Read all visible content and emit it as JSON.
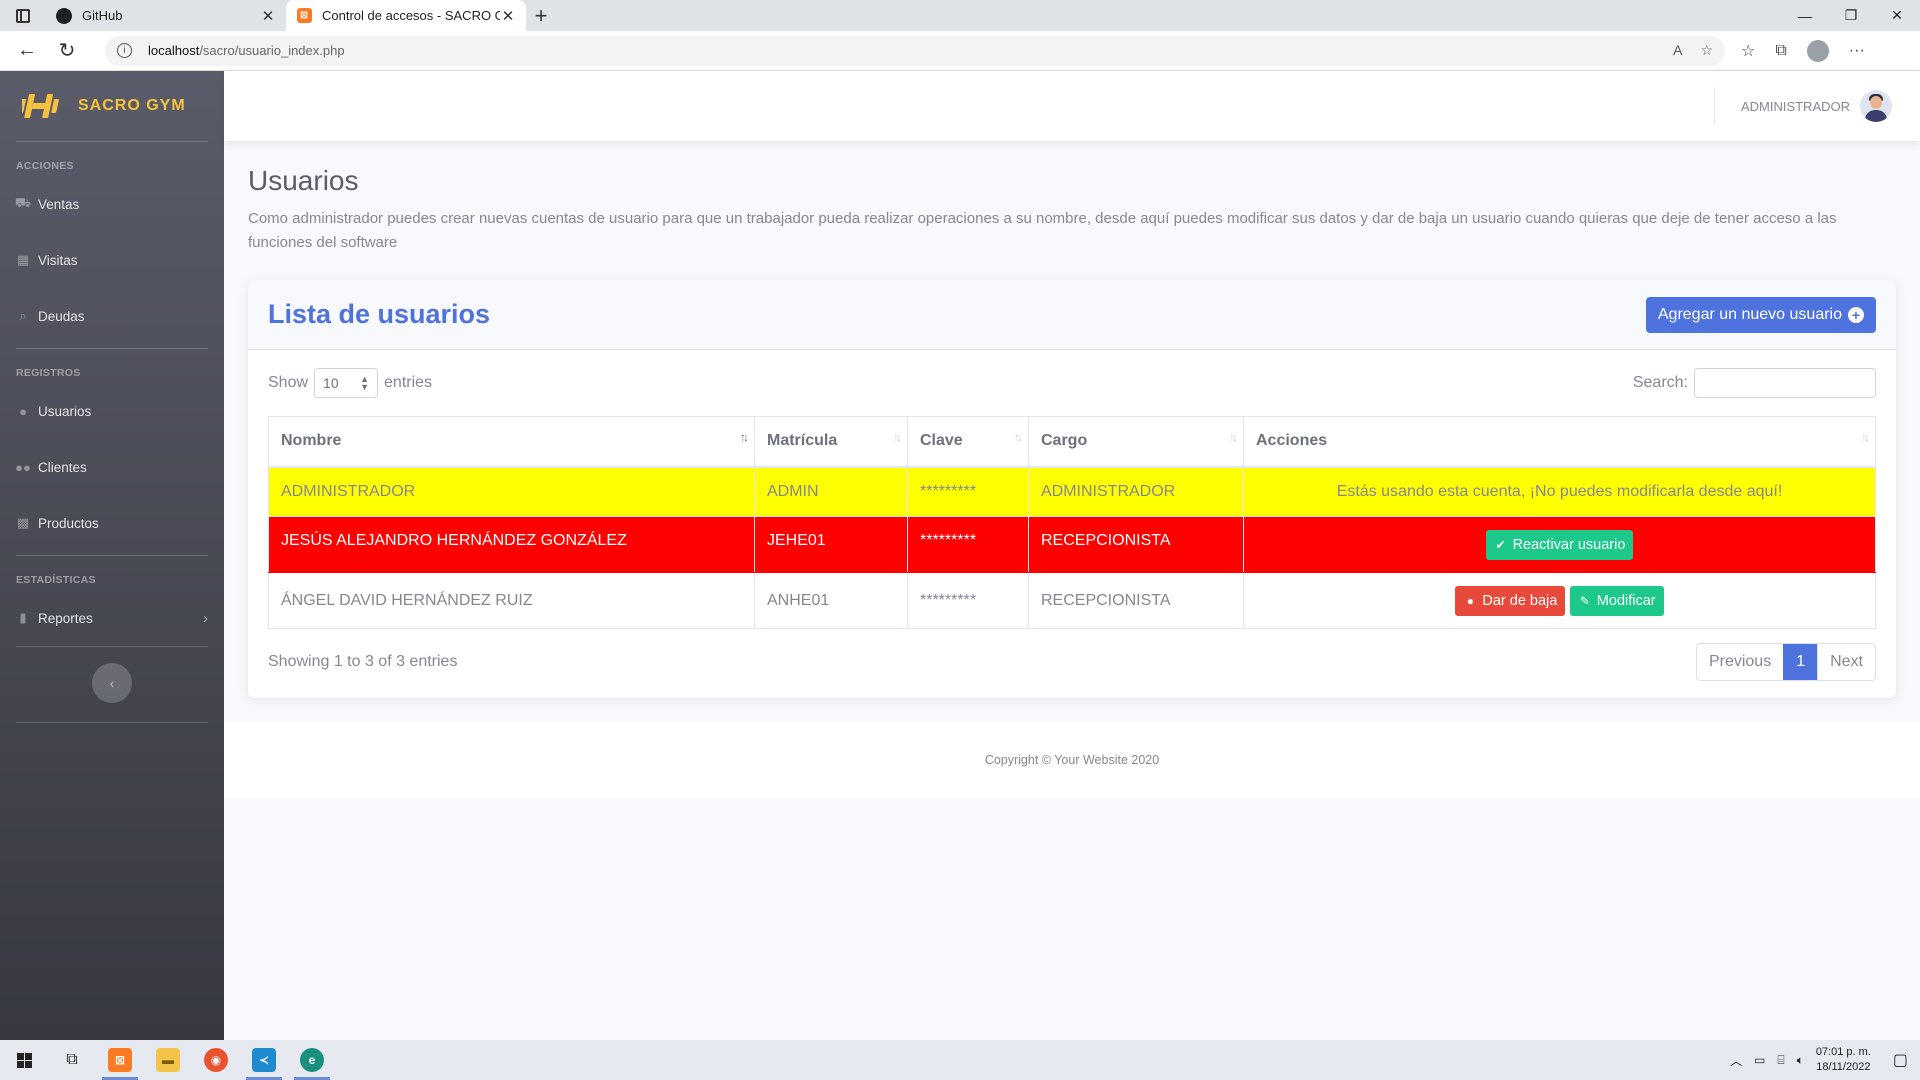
{
  "browser": {
    "tabs": [
      {
        "title": "GitHub",
        "active": false
      },
      {
        "title": "Control de accesos - SACRO GYM",
        "active": true
      }
    ],
    "url_host": "localhost",
    "url_path": "/sacro/usuario_index.php"
  },
  "sidebar": {
    "brand": "SACRO GYM",
    "sections": [
      {
        "heading": "ACCIONES",
        "items": [
          {
            "label": "Ventas",
            "icon": "dolly-icon"
          },
          {
            "label": "Visitas",
            "icon": "calendar-icon"
          },
          {
            "label": "Deudas",
            "icon": "search-dollar-icon"
          }
        ]
      },
      {
        "heading": "REGISTROS",
        "items": [
          {
            "label": "Usuarios",
            "icon": "user-icon"
          },
          {
            "label": "Clientes",
            "icon": "users-icon"
          },
          {
            "label": "Productos",
            "icon": "boxes-icon"
          }
        ]
      },
      {
        "heading": "ESTADÍSTICAS",
        "items": [
          {
            "label": "Reportes",
            "icon": "file-icon"
          }
        ]
      }
    ]
  },
  "topbar": {
    "user_name": "ADMINISTRADOR"
  },
  "page": {
    "title": "Usuarios",
    "description": "Como administrador puedes crear nuevas cuentas de usuario para que un trabajador pueda realizar operaciones a su nombre, desde aquí puedes modificar sus datos y dar de baja un usuario cuando quieras que deje de tener acceso a las funciones del software"
  },
  "card": {
    "title": "Lista de usuarios",
    "add_button": "Agregar un nuevo usuario"
  },
  "datatable": {
    "show_label": "Show",
    "entries_label": "entries",
    "length_value": "10",
    "search_label": "Search:",
    "columns": [
      "Nombre",
      "Matrícula",
      "Clave",
      "Cargo",
      "Acciones"
    ],
    "rows": [
      {
        "nombre": "ADMINISTRADOR",
        "matricula": "ADMIN",
        "clave": "*********",
        "cargo": "ADMINISTRADOR",
        "acciones_text": "Estás usando esta cuenta, ¡No puedes modificarla desde aquí!",
        "row_color": "#ffff00"
      },
      {
        "nombre": "JESÚS ALEJANDRO HERNÁNDEZ GONZÁLEZ",
        "matricula": "JEHE01",
        "clave": "*********",
        "cargo": "RECEPCIONISTA",
        "reactivate_button": "Reactivar usuario",
        "row_color": "#ff0000"
      },
      {
        "nombre": "ÁNGEL DAVID HERNÁNDEZ RUIZ",
        "matricula": "ANHE01",
        "clave": "*********",
        "cargo": "RECEPCIONISTA",
        "deactivate_button": "Dar de baja",
        "modify_button": "Modificar",
        "row_color": "#ffffff"
      }
    ],
    "info": "Showing 1 to 3 of 3 entries",
    "pager": {
      "previous": "Previous",
      "current": "1",
      "next": "Next"
    }
  },
  "footer": {
    "copyright": "Copyright © Your Website 2020"
  },
  "taskbar": {
    "time": "07:01 p. m.",
    "date": "18/11/2022"
  },
  "colors": {
    "primary": "#4e73df",
    "success": "#1cc88a",
    "danger": "#e74a3b",
    "brand": "#f6c23e"
  }
}
